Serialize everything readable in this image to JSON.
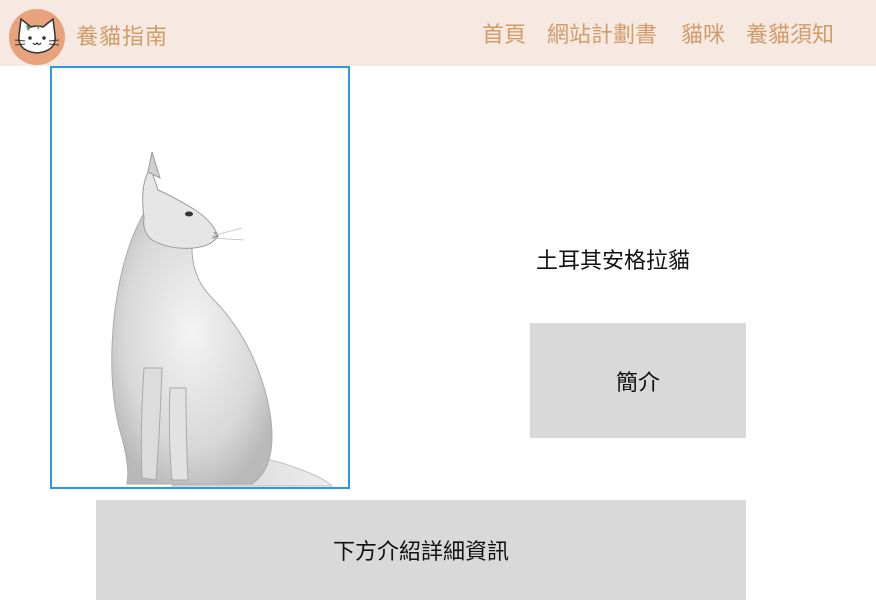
{
  "header": {
    "logo_icon": "cat-face-icon",
    "brand": "養貓指南",
    "nav": [
      "首頁",
      "網站計劃書",
      "貓咪",
      "養貓須知"
    ]
  },
  "colors": {
    "header_bg": "#f6e9e1",
    "accent_text": "#d29c6a",
    "logo_bg": "#e8a37c",
    "photo_border": "#2b97f0",
    "box_bg": "#d9d9d9"
  },
  "main": {
    "photo_icon": "white-cat-photo",
    "breed_title": "土耳其安格拉貓",
    "intro_label": "簡介",
    "detail_label": "下方介紹詳細資訊"
  }
}
